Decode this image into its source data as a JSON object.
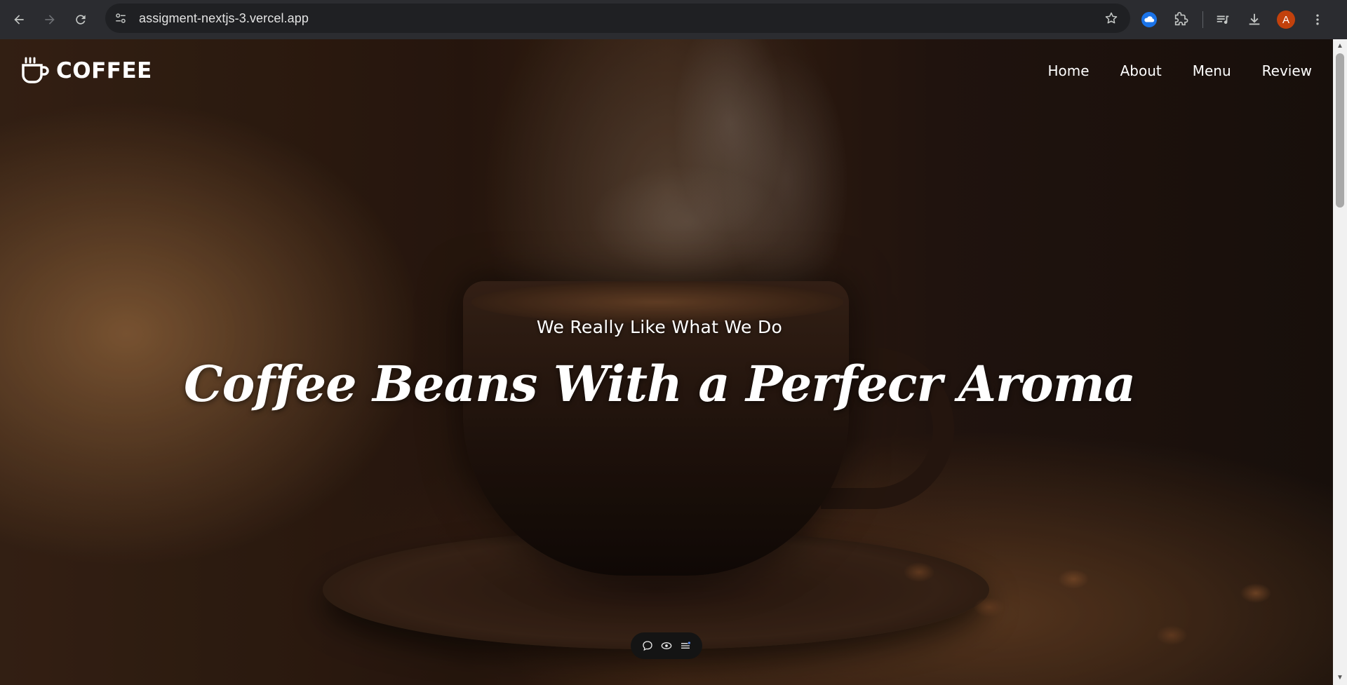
{
  "browser": {
    "url": "assigment-nextjs-3.vercel.app",
    "profile_initial": "A",
    "icons": {
      "back": "arrow-left-icon",
      "forward": "arrow-right-icon",
      "reload": "reload-icon",
      "site_info": "tune-icon",
      "bookmark": "star-icon",
      "extension_cloud": "cloud-upload-icon",
      "extensions": "puzzle-icon",
      "media": "media-queue-icon",
      "downloads": "download-icon",
      "menu": "kebab-menu-icon"
    },
    "colors": {
      "chrome_bg": "#2b2c30",
      "omnibox_bg": "#1f2023",
      "avatar_bg": "#c2410c",
      "cloud_icon": "#1a73e8"
    }
  },
  "site": {
    "logo_text": "COFFEE",
    "logo_icon": "coffee-cup-icon",
    "nav": [
      "Home",
      "About",
      "Menu",
      "Review"
    ]
  },
  "hero": {
    "subtitle": "We Really Like What We Do",
    "title": "Coffee Beans With a Perfecr Aroma"
  },
  "floating_toolbar": {
    "icons": [
      "comment-icon",
      "eye-icon",
      "list-menu-icon"
    ]
  }
}
